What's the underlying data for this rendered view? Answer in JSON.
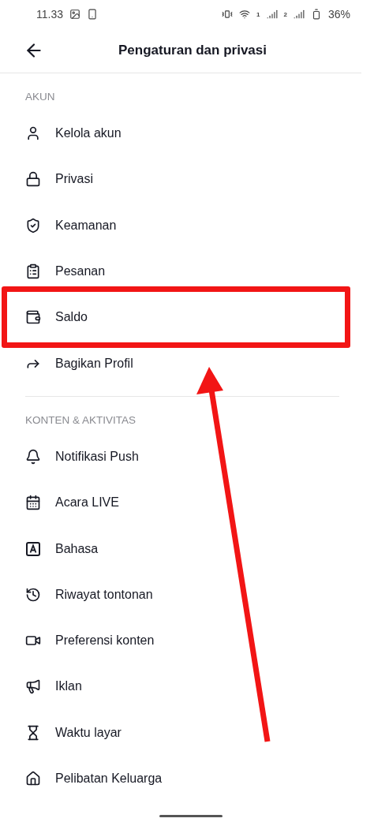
{
  "status_bar": {
    "time": "11.33",
    "sims": [
      "1",
      "2"
    ],
    "battery": "36%"
  },
  "header": {
    "title": "Pengaturan dan privasi"
  },
  "sections": [
    {
      "title": "AKUN",
      "items": [
        {
          "label": "Kelola akun",
          "highlighted": false
        },
        {
          "label": "Privasi",
          "highlighted": false
        },
        {
          "label": "Keamanan",
          "highlighted": false
        },
        {
          "label": "Pesanan",
          "highlighted": false
        },
        {
          "label": "Saldo",
          "highlighted": true
        },
        {
          "label": "Bagikan Profil",
          "highlighted": false
        }
      ]
    },
    {
      "title": "KONTEN & AKTIVITAS",
      "items": [
        {
          "label": "Notifikasi Push",
          "highlighted": false
        },
        {
          "label": "Acara LIVE",
          "highlighted": false
        },
        {
          "label": "Bahasa",
          "highlighted": false
        },
        {
          "label": "Riwayat tontonan",
          "highlighted": false
        },
        {
          "label": "Preferensi konten",
          "highlighted": false
        },
        {
          "label": "Iklan",
          "highlighted": false
        },
        {
          "label": "Waktu layar",
          "highlighted": false
        },
        {
          "label": "Pelibatan Keluarga",
          "highlighted": false
        }
      ]
    }
  ]
}
